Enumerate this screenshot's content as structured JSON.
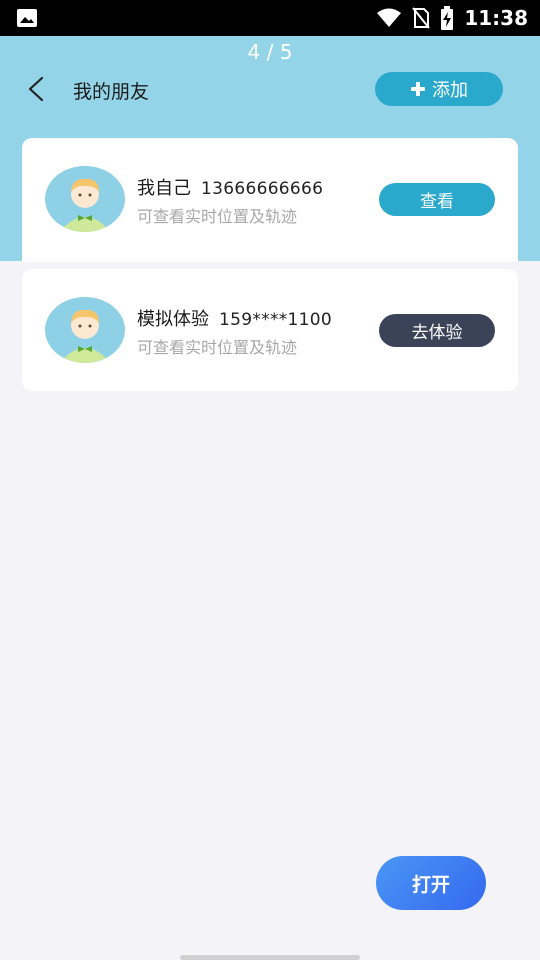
{
  "status_bar": {
    "time": "11:38",
    "icons": [
      "image-icon",
      "wifi-icon",
      "no-sim-icon",
      "battery-charging-icon"
    ]
  },
  "pager": {
    "text": "4 / 5"
  },
  "header": {
    "title": "我的朋友",
    "add_label": "添加"
  },
  "friends": [
    {
      "name": "我自己",
      "phone": "13666666666",
      "desc": "可查看实时位置及轨迹",
      "action": "查看"
    },
    {
      "name": "模拟体验",
      "phone": "159****1100",
      "desc": "可查看实时位置及轨迹",
      "action": "去体验"
    }
  ],
  "footer": {
    "open_label": "打开"
  },
  "colors": {
    "header_bg": "#93d4e8",
    "accent": "#2ba9cd",
    "dark_button": "#3b4358",
    "open_gradient_start": "#4a96f5",
    "open_gradient_end": "#3569ef"
  }
}
